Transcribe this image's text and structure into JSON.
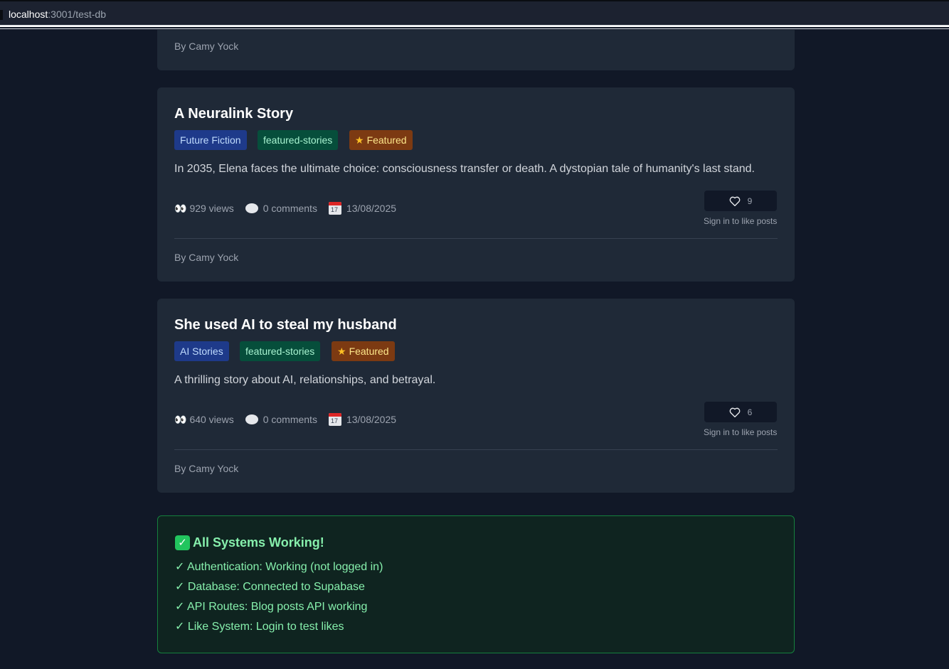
{
  "browser": {
    "url_host": "localhost",
    "url_path": ":3001/test-db"
  },
  "top_card": {
    "author": "By Camy Yock"
  },
  "posts": [
    {
      "title": "A Neuralink Story",
      "category": "Future Fiction",
      "slug": "featured-stories",
      "featured_label": "Featured",
      "excerpt": "In 2035, Elena faces the ultimate choice: consciousness transfer or death. A dystopian tale of humanity's last stand.",
      "views": "929 views",
      "comments": "0 comments",
      "date": "13/08/2025",
      "likes": "9",
      "like_note": "Sign in to like posts",
      "author": "By Camy Yock"
    },
    {
      "title": "She used AI to steal my husband",
      "category": "AI Stories",
      "slug": "featured-stories",
      "featured_label": "Featured",
      "excerpt": "A thrilling story about AI, relationships, and betrayal.",
      "views": "640 views",
      "comments": "0 comments",
      "date": "13/08/2025",
      "likes": "6",
      "like_note": "Sign in to like posts",
      "author": "By Camy Yock"
    }
  ],
  "status": {
    "title": "All Systems Working!",
    "items": [
      "✓ Authentication: Working (not logged in)",
      "✓ Database: Connected to Supabase",
      "✓ API Routes: Blog posts API working",
      "✓ Like System: Login to test likes"
    ]
  },
  "icons": {
    "views": "eyes-icon",
    "comments": "speech-bubble-icon",
    "date": "calendar-icon",
    "like": "heart-icon",
    "featured": "star-icon",
    "status": "check-box-icon"
  }
}
